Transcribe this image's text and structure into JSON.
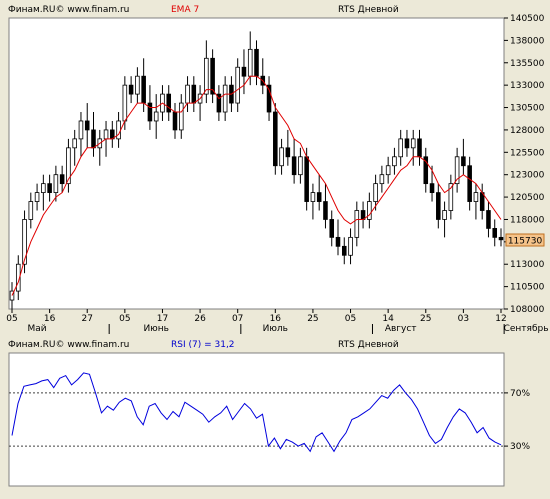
{
  "header": {
    "source": "Финам.RU© www.finam.ru",
    "ema_label": "EMA 7",
    "title": "RTS Дневной"
  },
  "rsi_header": {
    "source": "Финам.RU© www.finam.ru",
    "rsi_label": "RSI (7) = 31,2",
    "title": "RTS Дневной"
  },
  "colors": {
    "background": "#ece9d8",
    "plot": "#ffffff",
    "candle_up": "#ffffff",
    "candle_down": "#000000",
    "ema": "#e00000",
    "rsi": "#0000dd",
    "last_price_box": "#f5c38a"
  },
  "chart_data": [
    {
      "type": "candlestick",
      "title": "RTS Дневной",
      "indicator": "EMA 7",
      "ylim": [
        108000,
        140500
      ],
      "y_ticks": [
        "140500",
        "138000",
        "135500",
        "133000",
        "130500",
        "128000",
        "125500",
        "123000",
        "120500",
        "118000",
        "115500",
        "113000",
        "110500",
        "108000"
      ],
      "x_tick_labels": [
        "05",
        "16",
        "27",
        "05",
        "17",
        "26",
        "07",
        "16",
        "25",
        "05",
        "14",
        "25",
        "03",
        "12"
      ],
      "x_tick_index": [
        0,
        6,
        12,
        18,
        24,
        30,
        36,
        42,
        48,
        54,
        60,
        66,
        72,
        78
      ],
      "month_labels": [
        "Май",
        "Июнь",
        "Июль",
        "Август",
        "Сентябрь"
      ],
      "month_label_index": [
        4,
        23,
        42,
        62,
        82
      ],
      "month_sep_index": [
        16,
        37,
        58,
        79
      ],
      "last_price_label": "115730",
      "candles": [
        [
          109,
          111,
          108,
          110
        ],
        [
          110,
          114,
          109,
          113
        ],
        [
          113,
          119,
          112,
          118
        ],
        [
          118,
          121,
          117,
          120
        ],
        [
          120,
          122,
          119,
          121
        ],
        [
          121,
          123,
          119,
          122
        ],
        [
          122,
          123,
          120,
          121
        ],
        [
          121,
          124,
          120,
          123
        ],
        [
          123,
          124,
          121,
          122
        ],
        [
          122,
          127,
          121,
          126
        ],
        [
          126,
          128,
          124,
          127
        ],
        [
          127,
          130,
          125,
          129
        ],
        [
          129,
          131,
          126,
          128
        ],
        [
          128,
          130,
          125,
          126
        ],
        [
          126,
          128,
          124,
          127
        ],
        [
          127,
          129,
          125,
          128
        ],
        [
          128,
          129,
          126,
          127
        ],
        [
          127,
          130,
          126,
          129
        ],
        [
          129,
          134,
          128,
          133
        ],
        [
          133,
          134,
          131,
          132
        ],
        [
          132,
          135,
          131,
          134
        ],
        [
          134,
          136,
          130,
          131
        ],
        [
          131,
          133,
          128,
          129
        ],
        [
          129,
          132,
          127,
          130
        ],
        [
          130,
          133,
          129,
          132
        ],
        [
          132,
          133,
          129,
          130
        ],
        [
          130,
          131,
          127,
          128
        ],
        [
          128,
          132,
          127,
          131
        ],
        [
          131,
          134,
          130,
          133
        ],
        [
          133,
          134,
          130,
          131
        ],
        [
          131,
          133,
          129,
          132
        ],
        [
          132,
          138,
          131,
          136
        ],
        [
          136,
          137,
          131,
          132
        ],
        [
          132,
          133,
          129,
          130
        ],
        [
          130,
          134,
          129,
          133
        ],
        [
          133,
          134,
          130,
          131
        ],
        [
          131,
          136,
          130,
          135
        ],
        [
          135,
          137,
          132,
          134
        ],
        [
          134,
          139,
          133,
          137
        ],
        [
          137,
          138,
          133,
          134
        ],
        [
          134,
          136,
          132,
          133
        ],
        [
          133,
          134,
          129,
          130
        ],
        [
          130,
          131,
          123,
          124
        ],
        [
          124,
          127,
          123,
          126
        ],
        [
          126,
          128,
          124,
          125
        ],
        [
          125,
          127,
          122,
          123
        ],
        [
          123,
          126,
          122,
          125
        ],
        [
          125,
          126,
          119,
          120
        ],
        [
          120,
          122,
          118,
          121
        ],
        [
          121,
          123,
          119,
          120
        ],
        [
          120,
          122,
          117,
          118
        ],
        [
          118,
          119,
          115,
          116
        ],
        [
          116,
          118,
          114,
          115
        ],
        [
          115,
          116,
          113,
          114
        ],
        [
          114,
          117,
          113,
          116
        ],
        [
          116,
          120,
          115,
          119
        ],
        [
          119,
          120,
          117,
          118
        ],
        [
          118,
          121,
          117,
          120
        ],
        [
          120,
          123,
          119,
          122
        ],
        [
          122,
          124,
          121,
          123
        ],
        [
          123,
          125,
          122,
          124
        ],
        [
          124,
          126,
          123,
          125
        ],
        [
          125,
          128,
          124,
          127
        ],
        [
          127,
          128,
          125,
          126
        ],
        [
          126,
          128,
          124,
          127
        ],
        [
          127,
          128,
          124,
          125
        ],
        [
          125,
          126,
          121,
          122
        ],
        [
          122,
          124,
          120,
          121
        ],
        [
          121,
          122,
          117,
          118
        ],
        [
          118,
          120,
          116,
          119
        ],
        [
          119,
          123,
          118,
          122
        ],
        [
          122,
          126,
          121,
          125
        ],
        [
          125,
          127,
          123,
          124
        ],
        [
          124,
          125,
          119,
          120
        ],
        [
          120,
          122,
          118,
          121
        ],
        [
          121,
          122,
          118,
          119
        ],
        [
          119,
          120,
          116,
          117
        ],
        [
          117,
          118,
          115,
          116
        ],
        [
          116,
          117,
          115,
          115.73
        ]
      ],
      "ema7": [
        109.5,
        111,
        113.5,
        115.5,
        117,
        118.5,
        119.5,
        120.5,
        121,
        122.5,
        123.5,
        125,
        126,
        126,
        126.5,
        127,
        127,
        127.5,
        129,
        130,
        131,
        131,
        130.5,
        130.5,
        131,
        130.5,
        130,
        130,
        131,
        131,
        131.5,
        132.5,
        132.5,
        131.5,
        132,
        132,
        132.5,
        133,
        134,
        134,
        133.5,
        132.5,
        130.5,
        129.5,
        128.5,
        127,
        126.5,
        125,
        124,
        123,
        122,
        120.5,
        119,
        118,
        117.5,
        118,
        118,
        118.5,
        119.5,
        120.5,
        121.5,
        122.5,
        123.5,
        124,
        125,
        125,
        124.5,
        123.5,
        122,
        121,
        121.5,
        122.5,
        123,
        122.5,
        122,
        121,
        120,
        119,
        118
      ]
    },
    {
      "type": "line",
      "title": "RSI (7) = 31,2",
      "ylim": [
        0,
        100
      ],
      "levels": [
        70,
        30
      ],
      "level_labels": [
        "70%",
        "30%"
      ],
      "values": [
        38,
        62,
        75,
        76,
        77,
        79,
        80,
        74,
        81,
        83,
        76,
        80,
        85,
        84,
        70,
        55,
        60,
        57,
        63,
        66,
        64,
        52,
        46,
        60,
        62,
        55,
        50,
        56,
        52,
        63,
        60,
        57,
        54,
        48,
        52,
        55,
        60,
        50,
        56,
        62,
        58,
        51,
        54,
        30,
        36,
        28,
        35,
        33,
        30,
        32,
        26,
        37,
        40,
        33,
        26,
        34,
        40,
        50,
        52,
        55,
        58,
        63,
        68,
        66,
        72,
        76,
        70,
        65,
        58,
        48,
        38,
        32,
        35,
        44,
        52,
        58,
        55,
        48,
        40,
        44,
        36,
        33,
        31
      ]
    }
  ]
}
